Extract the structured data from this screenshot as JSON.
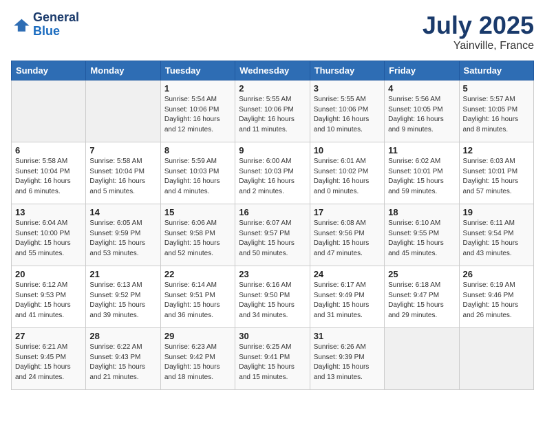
{
  "header": {
    "logo_line1": "General",
    "logo_line2": "Blue",
    "month": "July 2025",
    "location": "Yainville, France"
  },
  "weekdays": [
    "Sunday",
    "Monday",
    "Tuesday",
    "Wednesday",
    "Thursday",
    "Friday",
    "Saturday"
  ],
  "weeks": [
    [
      {
        "day": "",
        "info": ""
      },
      {
        "day": "",
        "info": ""
      },
      {
        "day": "1",
        "info": "Sunrise: 5:54 AM\nSunset: 10:06 PM\nDaylight: 16 hours\nand 12 minutes."
      },
      {
        "day": "2",
        "info": "Sunrise: 5:55 AM\nSunset: 10:06 PM\nDaylight: 16 hours\nand 11 minutes."
      },
      {
        "day": "3",
        "info": "Sunrise: 5:55 AM\nSunset: 10:06 PM\nDaylight: 16 hours\nand 10 minutes."
      },
      {
        "day": "4",
        "info": "Sunrise: 5:56 AM\nSunset: 10:05 PM\nDaylight: 16 hours\nand 9 minutes."
      },
      {
        "day": "5",
        "info": "Sunrise: 5:57 AM\nSunset: 10:05 PM\nDaylight: 16 hours\nand 8 minutes."
      }
    ],
    [
      {
        "day": "6",
        "info": "Sunrise: 5:58 AM\nSunset: 10:04 PM\nDaylight: 16 hours\nand 6 minutes."
      },
      {
        "day": "7",
        "info": "Sunrise: 5:58 AM\nSunset: 10:04 PM\nDaylight: 16 hours\nand 5 minutes."
      },
      {
        "day": "8",
        "info": "Sunrise: 5:59 AM\nSunset: 10:03 PM\nDaylight: 16 hours\nand 4 minutes."
      },
      {
        "day": "9",
        "info": "Sunrise: 6:00 AM\nSunset: 10:03 PM\nDaylight: 16 hours\nand 2 minutes."
      },
      {
        "day": "10",
        "info": "Sunrise: 6:01 AM\nSunset: 10:02 PM\nDaylight: 16 hours\nand 0 minutes."
      },
      {
        "day": "11",
        "info": "Sunrise: 6:02 AM\nSunset: 10:01 PM\nDaylight: 15 hours\nand 59 minutes."
      },
      {
        "day": "12",
        "info": "Sunrise: 6:03 AM\nSunset: 10:01 PM\nDaylight: 15 hours\nand 57 minutes."
      }
    ],
    [
      {
        "day": "13",
        "info": "Sunrise: 6:04 AM\nSunset: 10:00 PM\nDaylight: 15 hours\nand 55 minutes."
      },
      {
        "day": "14",
        "info": "Sunrise: 6:05 AM\nSunset: 9:59 PM\nDaylight: 15 hours\nand 53 minutes."
      },
      {
        "day": "15",
        "info": "Sunrise: 6:06 AM\nSunset: 9:58 PM\nDaylight: 15 hours\nand 52 minutes."
      },
      {
        "day": "16",
        "info": "Sunrise: 6:07 AM\nSunset: 9:57 PM\nDaylight: 15 hours\nand 50 minutes."
      },
      {
        "day": "17",
        "info": "Sunrise: 6:08 AM\nSunset: 9:56 PM\nDaylight: 15 hours\nand 47 minutes."
      },
      {
        "day": "18",
        "info": "Sunrise: 6:10 AM\nSunset: 9:55 PM\nDaylight: 15 hours\nand 45 minutes."
      },
      {
        "day": "19",
        "info": "Sunrise: 6:11 AM\nSunset: 9:54 PM\nDaylight: 15 hours\nand 43 minutes."
      }
    ],
    [
      {
        "day": "20",
        "info": "Sunrise: 6:12 AM\nSunset: 9:53 PM\nDaylight: 15 hours\nand 41 minutes."
      },
      {
        "day": "21",
        "info": "Sunrise: 6:13 AM\nSunset: 9:52 PM\nDaylight: 15 hours\nand 39 minutes."
      },
      {
        "day": "22",
        "info": "Sunrise: 6:14 AM\nSunset: 9:51 PM\nDaylight: 15 hours\nand 36 minutes."
      },
      {
        "day": "23",
        "info": "Sunrise: 6:16 AM\nSunset: 9:50 PM\nDaylight: 15 hours\nand 34 minutes."
      },
      {
        "day": "24",
        "info": "Sunrise: 6:17 AM\nSunset: 9:49 PM\nDaylight: 15 hours\nand 31 minutes."
      },
      {
        "day": "25",
        "info": "Sunrise: 6:18 AM\nSunset: 9:47 PM\nDaylight: 15 hours\nand 29 minutes."
      },
      {
        "day": "26",
        "info": "Sunrise: 6:19 AM\nSunset: 9:46 PM\nDaylight: 15 hours\nand 26 minutes."
      }
    ],
    [
      {
        "day": "27",
        "info": "Sunrise: 6:21 AM\nSunset: 9:45 PM\nDaylight: 15 hours\nand 24 minutes."
      },
      {
        "day": "28",
        "info": "Sunrise: 6:22 AM\nSunset: 9:43 PM\nDaylight: 15 hours\nand 21 minutes."
      },
      {
        "day": "29",
        "info": "Sunrise: 6:23 AM\nSunset: 9:42 PM\nDaylight: 15 hours\nand 18 minutes."
      },
      {
        "day": "30",
        "info": "Sunrise: 6:25 AM\nSunset: 9:41 PM\nDaylight: 15 hours\nand 15 minutes."
      },
      {
        "day": "31",
        "info": "Sunrise: 6:26 AM\nSunset: 9:39 PM\nDaylight: 15 hours\nand 13 minutes."
      },
      {
        "day": "",
        "info": ""
      },
      {
        "day": "",
        "info": ""
      }
    ]
  ]
}
